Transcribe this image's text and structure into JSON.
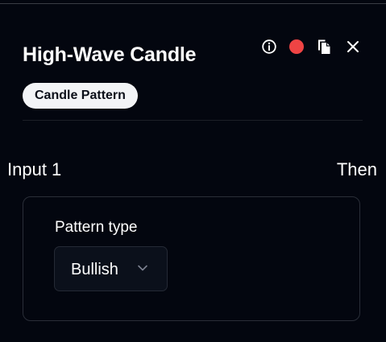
{
  "panel": {
    "title": "High-Wave Candle",
    "badge": "Candle Pattern"
  },
  "toolbar": {
    "icons": [
      "info-icon",
      "status-dot-icon",
      "copy-icon",
      "close-icon"
    ],
    "status_color": "#ef4444"
  },
  "connections": {
    "input_label": "Input 1",
    "output_label": "Then"
  },
  "fields": {
    "pattern_type": {
      "label": "Pattern type",
      "value": "Bullish"
    }
  },
  "colors": {
    "background": "#03060f",
    "badge_background": "#f3f4f6",
    "select_background": "#0b101b"
  }
}
